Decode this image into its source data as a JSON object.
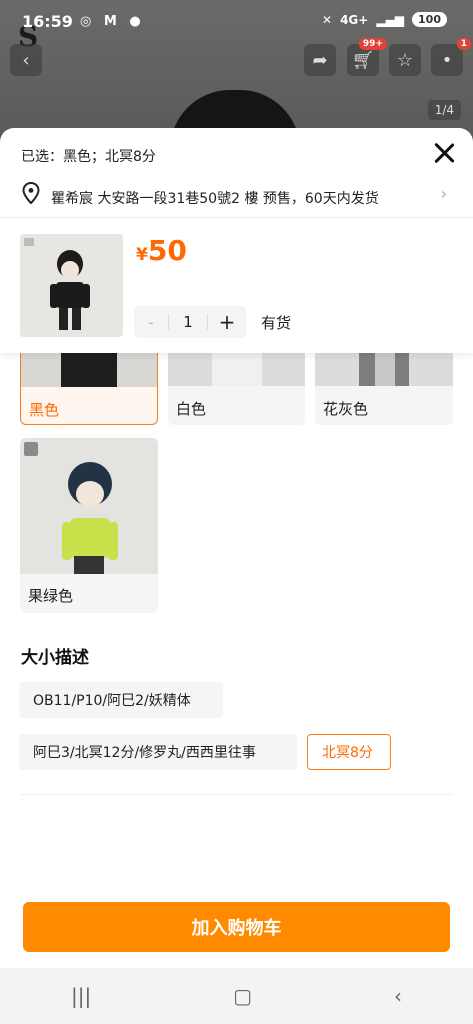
{
  "status_bar": {
    "time": "16:59",
    "notification_icons": "◎ M ●",
    "signal": "4G+",
    "battery": "100"
  },
  "top_nav": {
    "cart_badge": "99+",
    "message_badge": "1",
    "image_counter": "1/4"
  },
  "sheet": {
    "selected_text": "已选：黑色；北冥8分",
    "address": "瞿希宸 大安路一段31巷50號2 樓  预售，60天内发货",
    "price_currency": "¥",
    "price_value": "50",
    "quantity": "1",
    "minus_label": "-",
    "plus_label": "+",
    "stock_status": "有货"
  },
  "color_options": [
    {
      "label": "黑色",
      "selected": true
    },
    {
      "label": "白色",
      "selected": false
    },
    {
      "label": "花灰色",
      "selected": false
    },
    {
      "label": "果绿色",
      "selected": false
    }
  ],
  "size_section": {
    "title": "大小描述",
    "options": [
      {
        "label": "OB11/P10/阿巳2/妖精体",
        "selected": false
      },
      {
        "label": "阿巳3/北冥12分/修罗丸/西西里往事",
        "selected": false
      },
      {
        "label": "北冥8分",
        "selected": true
      }
    ]
  },
  "cart_button": "加入购物车",
  "colors": {
    "accent": "#ff6a00",
    "button": "#ff8a00"
  }
}
